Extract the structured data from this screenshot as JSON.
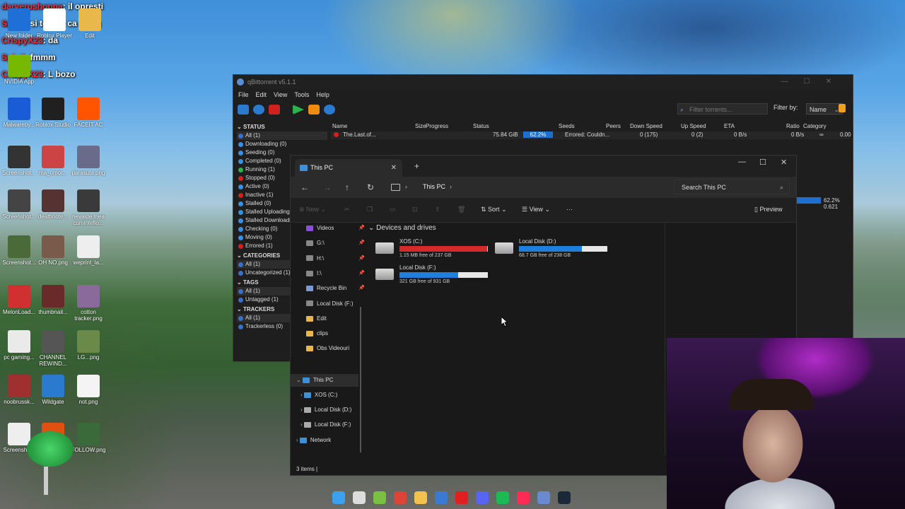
{
  "chat": [
    {
      "user": "daryerushoppa",
      "msg": ": il opresti"
    },
    {
      "user": "Spinti",
      "msg": ": si te miri ca ai lag"
    },
    {
      "user": "CrispyX23",
      "msg": ": da"
    },
    {
      "user": "Spinti",
      "msg": ": fmmm"
    },
    {
      "user": "CrispyX23",
      "msg": ": L bozo"
    }
  ],
  "desktop_icons": [
    {
      "label": "New folder",
      "color": "#1e6fd6"
    },
    {
      "label": "Roblox Player",
      "color": "#ffffff"
    },
    {
      "label": "Edit",
      "color": "#e8b84a"
    },
    {
      "label": "NVIDIA App",
      "color": "#76b900"
    },
    {
      "label": "Malwareby...",
      "color": "#1a5cd6"
    },
    {
      "label": "Roblox Studio",
      "color": "#202020"
    },
    {
      "label": "FACEIT AC",
      "color": "#ff5500"
    },
    {
      "label": "Screenshot...",
      "color": "#333"
    },
    {
      "label": "ma_omor...",
      "color": "#c44"
    },
    {
      "label": "parasuta.png",
      "color": "#6a6a8a"
    },
    {
      "label": "Screenshot...",
      "color": "#444"
    },
    {
      "label": "deathnote...",
      "color": "#533"
    },
    {
      "label": "nevaste mea cumintefio...",
      "color": "#3a3a3a"
    },
    {
      "label": "Screenshot...",
      "color": "#4a6a3a"
    },
    {
      "label": "OH NO.png",
      "color": "#7a5a4a"
    },
    {
      "label": "weprint_la...",
      "color": "#eeeeee"
    },
    {
      "label": "MelonLoad...",
      "color": "#d03030"
    },
    {
      "label": "thumbnail...",
      "color": "#6a2a2a"
    },
    {
      "label": "cotton tracker.png",
      "color": "#8a6a9a"
    },
    {
      "label": "pc gaming...",
      "color": "#eaeaea"
    },
    {
      "label": "CHANNEL REWIND...",
      "color": "#555"
    },
    {
      "label": "LG...png",
      "color": "#6a8a4a"
    },
    {
      "label": "noobrussk...",
      "color": "#a03030"
    },
    {
      "label": "Wildgate",
      "color": "#2a7ad0"
    },
    {
      "label": "not.png",
      "color": "#f4f4f4"
    },
    {
      "label": "Screensho...",
      "color": "#eee"
    },
    {
      "label": "",
      "color": "#e05010"
    },
    {
      "label": "FOLLOW.png",
      "color": "#3a6a3a"
    }
  ],
  "qbittorrent": {
    "title": "qBittorrent v5.1.1",
    "menu": [
      "File",
      "Edit",
      "View",
      "Tools",
      "Help"
    ],
    "filter_placeholder": "Filter torrents...",
    "filter_by_label": "Filter by:",
    "filter_by_value": "Name",
    "status_header": "STATUS",
    "status_items": [
      {
        "label": "All (1)",
        "color": "#3b6fc4"
      },
      {
        "label": "Downloading (0)",
        "color": "#3b8fe0"
      },
      {
        "label": "Seeding (0)",
        "color": "#3b8fe0"
      },
      {
        "label": "Completed (0)",
        "color": "#3b8fe0"
      },
      {
        "label": "Running (1)",
        "color": "#2bb24c"
      },
      {
        "label": "Stopped (0)",
        "color": "#d02020"
      },
      {
        "label": "Active (0)",
        "color": "#3b8fe0"
      },
      {
        "label": "Inactive (1)",
        "color": "#d02020"
      },
      {
        "label": "Stalled (0)",
        "color": "#3b8fe0"
      },
      {
        "label": "Stalled Uploading (0)",
        "color": "#3b8fe0"
      },
      {
        "label": "Stalled Downloading (0)",
        "color": "#3b8fe0"
      },
      {
        "label": "Checking (0)",
        "color": "#3b8fe0"
      },
      {
        "label": "Moving (0)",
        "color": "#3b8fe0"
      },
      {
        "label": "Errored (1)",
        "color": "#d02020"
      }
    ],
    "categories_header": "CATEGORIES",
    "category_items": [
      "All (1)",
      "Uncategorized (1)"
    ],
    "tags_header": "TAGS",
    "tag_items": [
      "All (1)",
      "Untagged (1)"
    ],
    "trackers_header": "TRACKERS",
    "tracker_items": [
      "All (1)",
      "Trackerless (0)"
    ],
    "columns": [
      "Name",
      "Size",
      "Progress",
      "Status",
      "Seeds",
      "Peers",
      "Down Speed",
      "Up Speed",
      "ETA",
      "Ratio",
      "Category"
    ],
    "row": {
      "name": "The.Last.of...",
      "size": "75.84 GiB",
      "progress": "62.2%",
      "progress_fraction": 0.622,
      "status": "Errored: Couldn...",
      "seeds": "0 (175)",
      "peers": "0 (2)",
      "down": "0 B/s",
      "up": "0 B/s",
      "eta": "∞",
      "ratio": "0.00"
    },
    "side_values": [
      "62.2%",
      "0.621"
    ]
  },
  "explorer": {
    "tab_title": "This PC",
    "address": "This PC",
    "search_placeholder": "Search This PC",
    "toolbar": {
      "new": "New",
      "sort": "Sort",
      "view": "View",
      "more": "···",
      "preview": "Preview"
    },
    "nav_pane": [
      {
        "label": "Videos",
        "pinned": true,
        "color": "#8a4fd8"
      },
      {
        "label": "G:\\",
        "pinned": true,
        "color": "#888"
      },
      {
        "label": "H:\\",
        "pinned": true,
        "color": "#888"
      },
      {
        "label": "I:\\",
        "pinned": true,
        "color": "#888"
      },
      {
        "label": "Recycle Bin",
        "pinned": true,
        "color": "#7a9ad0"
      },
      {
        "label": "Local Disk (F:)",
        "pinned": false,
        "color": "#888"
      },
      {
        "label": "Edit",
        "pinned": false,
        "color": "#e8b84a"
      },
      {
        "label": "clips",
        "pinned": false,
        "color": "#e8b84a"
      },
      {
        "label": "Obs Videouri",
        "pinned": false,
        "color": "#e8b84a"
      }
    ],
    "tree": [
      {
        "label": "This PC",
        "color": "#3d8fd8"
      },
      {
        "label": "XOS (C:)",
        "color": "#3d8fd8"
      },
      {
        "label": "Local Disk (D:)",
        "color": "#aaa"
      },
      {
        "label": "Local Disk (F:)",
        "color": "#aaa"
      },
      {
        "label": "Network",
        "color": "#3d8fd8"
      }
    ],
    "group_title": "Devices and drives",
    "drives": [
      {
        "name": "XOS (C:)",
        "free": "1.15 MB free of 237 GB",
        "used_fraction": 0.99,
        "color": "#d42a2a"
      },
      {
        "name": "Local Disk (D:)",
        "free": "68.7 GB free of 238 GB",
        "used_fraction": 0.71,
        "color": "#1f7fdc"
      },
      {
        "name": "Local Disk (F:)",
        "free": "321 GB free of 931 GB",
        "used_fraction": 0.66,
        "color": "#1f7fdc"
      }
    ],
    "status_bar": "3 items"
  },
  "taskbar": [
    {
      "name": "start-icon",
      "color": "#3aa0f0"
    },
    {
      "name": "search-icon",
      "color": "#dddddd"
    },
    {
      "name": "app-green-icon",
      "color": "#7ac043"
    },
    {
      "name": "chrome-icon",
      "color": "#db4437"
    },
    {
      "name": "file-explorer-icon",
      "color": "#f2c14e"
    },
    {
      "name": "browser-icon",
      "color": "#3a7ad0"
    },
    {
      "name": "youtube-icon",
      "color": "#e02020"
    },
    {
      "name": "discord-icon",
      "color": "#5865f2"
    },
    {
      "name": "spotify-icon",
      "color": "#1db954"
    },
    {
      "name": "tiktok-icon",
      "color": "#fe2c55"
    },
    {
      "name": "vpn-icon",
      "color": "#6a8ad0"
    },
    {
      "name": "steam-icon",
      "color": "#1b2838"
    }
  ]
}
